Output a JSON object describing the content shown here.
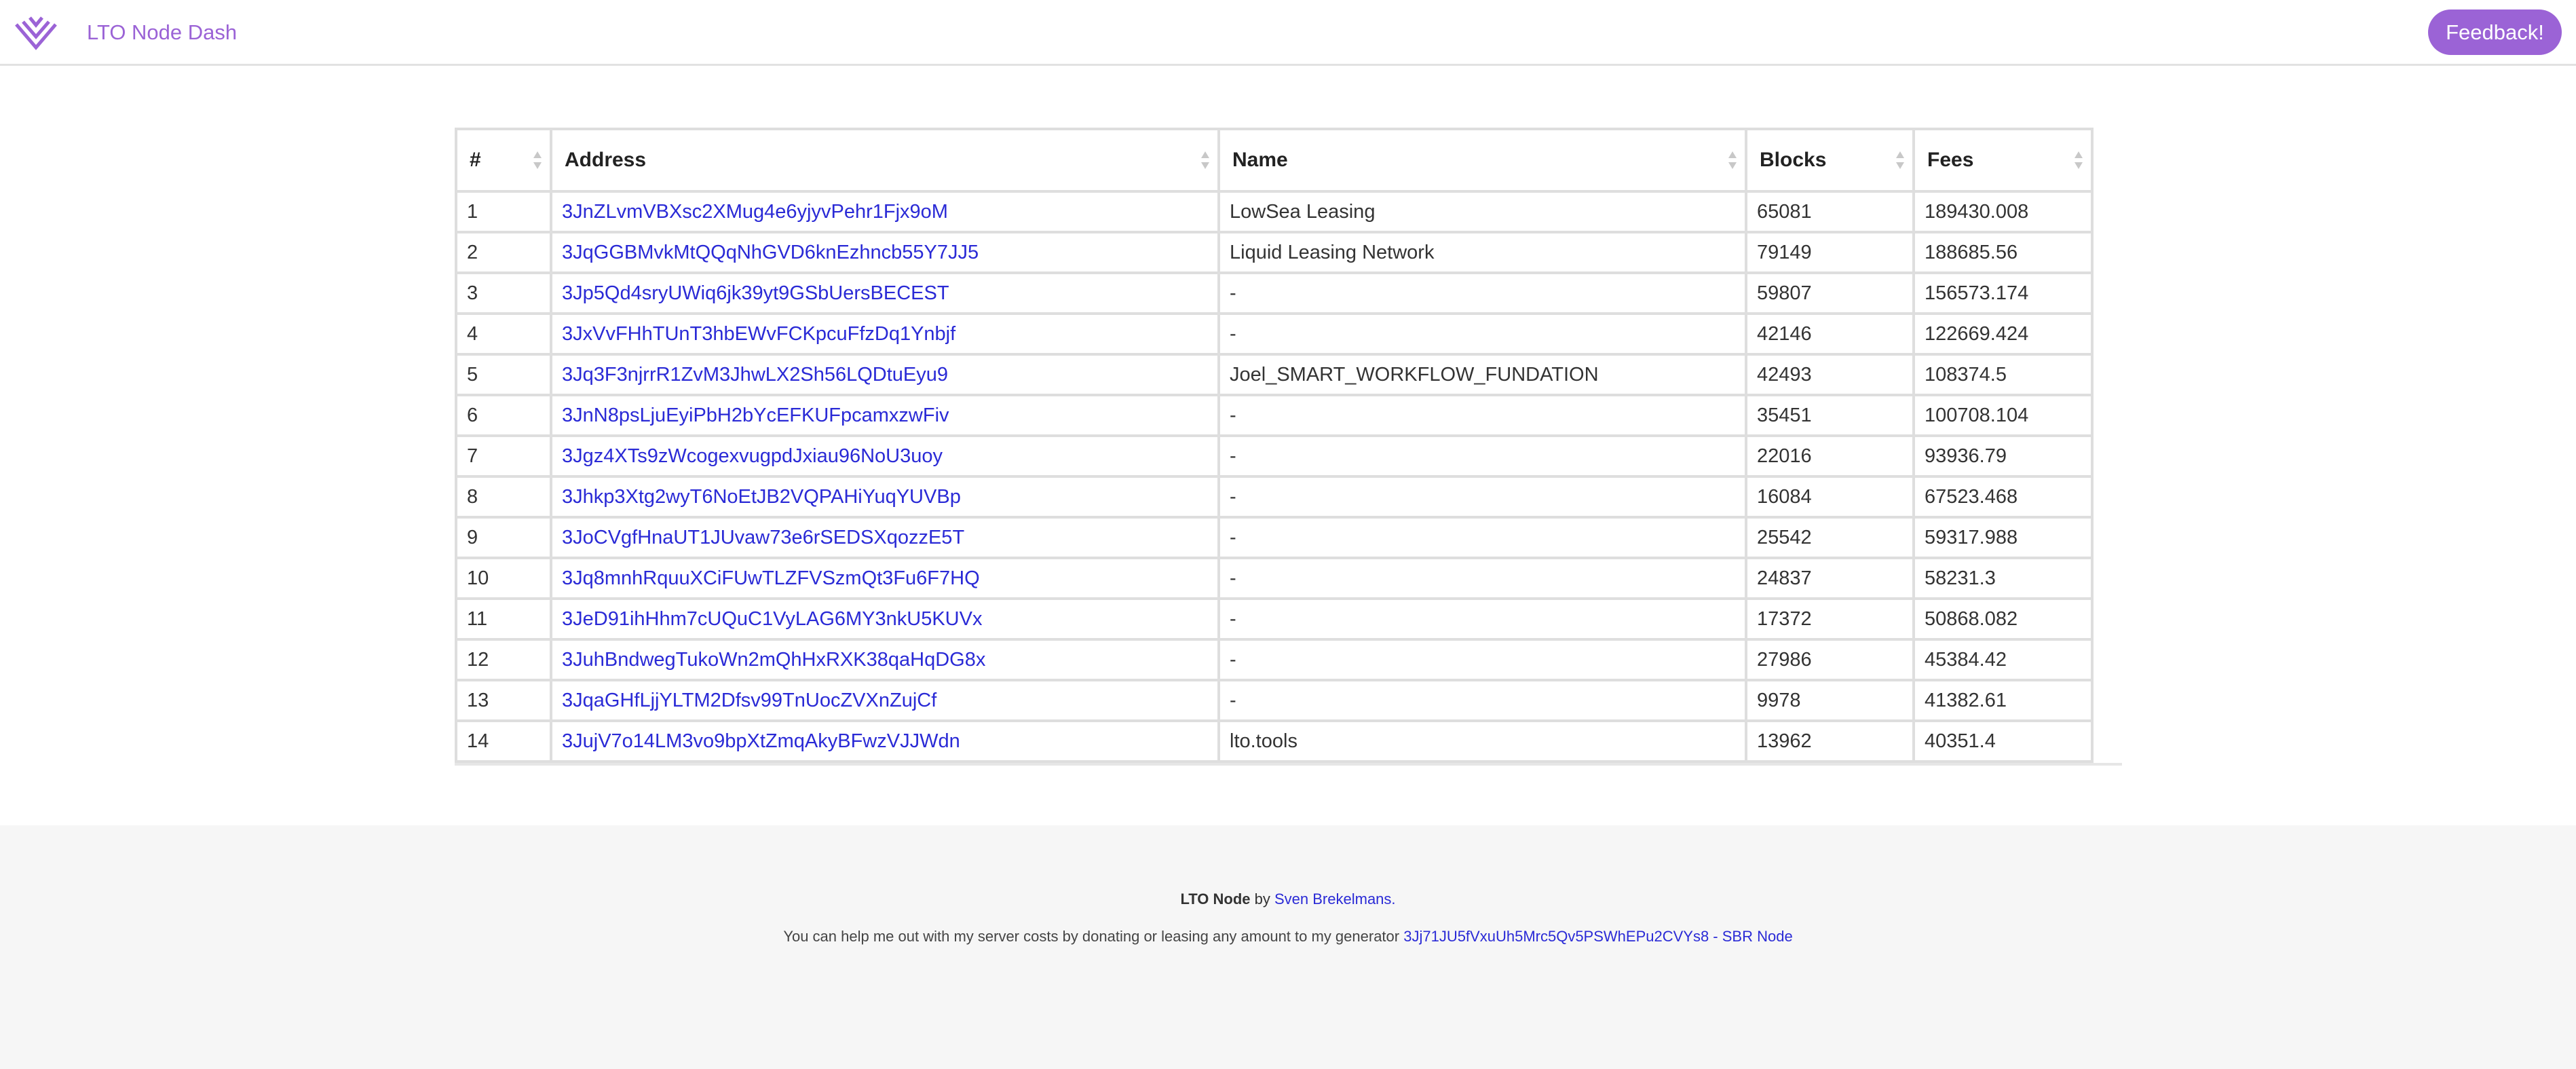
{
  "nav": {
    "brand": "LTO Node Dash",
    "feedback_label": "Feedback!",
    "brand_color": "#9b63d6"
  },
  "table": {
    "headers": [
      "#",
      "Address",
      "Name",
      "Blocks",
      "Fees"
    ],
    "rows": [
      {
        "rank": "1",
        "address": "3JnZLvmVBXsc2XMug4e6yjyvPehr1Fjx9oM",
        "name": "LowSea Leasing",
        "blocks": "65081",
        "fees": "189430.008"
      },
      {
        "rank": "2",
        "address": "3JqGGBMvkMtQQqNhGVD6knEzhncb55Y7JJ5",
        "name": "Liquid Leasing Network",
        "blocks": "79149",
        "fees": "188685.56"
      },
      {
        "rank": "3",
        "address": "3Jp5Qd4sryUWiq6jk39yt9GSbUersBECEST",
        "name": "-",
        "blocks": "59807",
        "fees": "156573.174"
      },
      {
        "rank": "4",
        "address": "3JxVvFHhTUnT3hbEWvFCKpcuFfzDq1Ynbjf",
        "name": "-",
        "blocks": "42146",
        "fees": "122669.424"
      },
      {
        "rank": "5",
        "address": "3Jq3F3njrrR1ZvM3JhwLX2Sh56LQDtuEyu9",
        "name": "Joel_SMART_WORKFLOW_FUNDATION",
        "blocks": "42493",
        "fees": "108374.5"
      },
      {
        "rank": "6",
        "address": "3JnN8psLjuEyiPbH2bYcEFKUFpcamxzwFiv",
        "name": "-",
        "blocks": "35451",
        "fees": "100708.104"
      },
      {
        "rank": "7",
        "address": "3Jgz4XTs9zWcogexvugpdJxiau96NoU3uoy",
        "name": "-",
        "blocks": "22016",
        "fees": "93936.79"
      },
      {
        "rank": "8",
        "address": "3Jhkp3Xtg2wyT6NoEtJB2VQPAHiYuqYUVBp",
        "name": "-",
        "blocks": "16084",
        "fees": "67523.468"
      },
      {
        "rank": "9",
        "address": "3JoCVgfHnaUT1JUvaw73e6rSEDSXqozzE5T",
        "name": "-",
        "blocks": "25542",
        "fees": "59317.988"
      },
      {
        "rank": "10",
        "address": "3Jq8mnhRquuXCiFUwTLZFVSzmQt3Fu6F7HQ",
        "name": "-",
        "blocks": "24837",
        "fees": "58231.3"
      },
      {
        "rank": "11",
        "address": "3JeD91ihHhm7cUQuC1VyLAG6MY3nkU5KUVx",
        "name": "-",
        "blocks": "17372",
        "fees": "50868.082"
      },
      {
        "rank": "12",
        "address": "3JuhBndwegTukoWn2mQhHxRXK38qaHqDG8x",
        "name": "-",
        "blocks": "27986",
        "fees": "45384.42"
      },
      {
        "rank": "13",
        "address": "3JqaGHfLjjYLTM2Dfsv99TnUocZVXnZujCf",
        "name": "-",
        "blocks": "9978",
        "fees": "41382.61"
      },
      {
        "rank": "14",
        "address": "3JujV7o14LM3vo9bpXtZmqAkyBFwzVJJWdn",
        "name": "lto.tools",
        "blocks": "13962",
        "fees": "40351.4"
      }
    ],
    "link_color": "#2a2ad6"
  },
  "footer": {
    "product": "LTO Node",
    "by_text": " by ",
    "author": "Sven Brekelmans.",
    "donate_text": "You can help me out with my server costs by donating or leasing any amount to my generator ",
    "generator_address": "3Jj71JU5fVxuUh5Mrc5Qv5PSWhEPu2CVYs8 - SBR Node"
  }
}
